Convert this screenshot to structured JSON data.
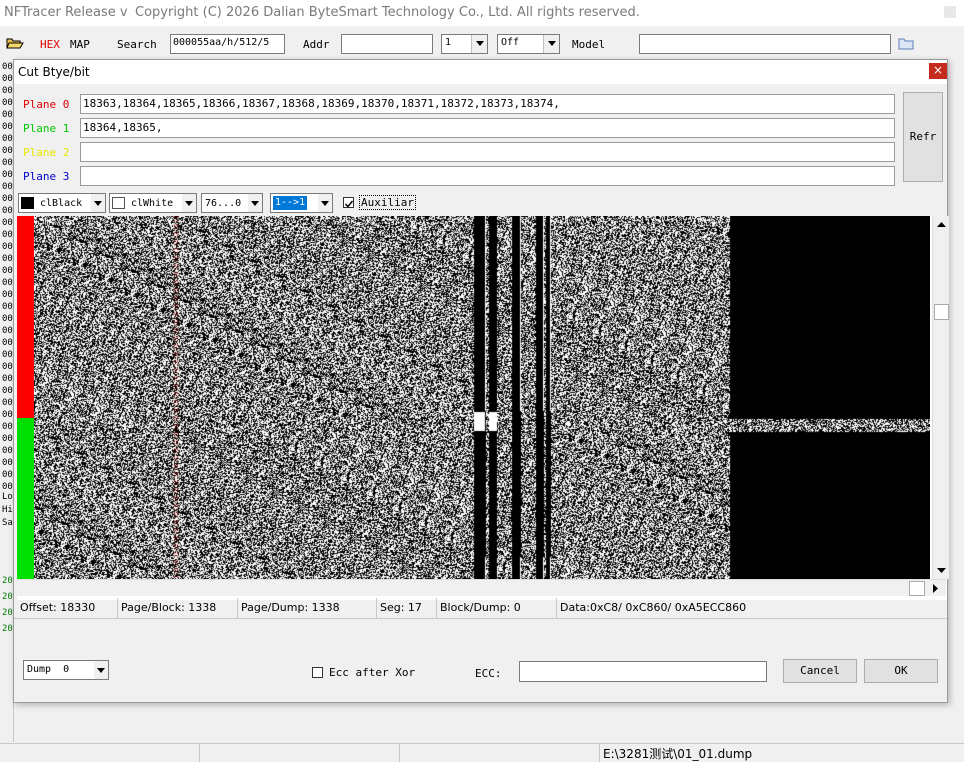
{
  "app": {
    "title": "NFTracer Release v",
    "copyright": "Copyright (C) 2026 Dalian ByteSmart Technology Co., Ltd. All rights reserved."
  },
  "toolbar": {
    "hex_label": "HEX",
    "map_label": "MAP",
    "search_label": "Search",
    "search_value": "000055aa/h/512/5",
    "addr_label": "Addr",
    "addr_value": "",
    "count_value": "1",
    "mode_value": "Off",
    "model_label": "Model",
    "model_value": ""
  },
  "left_strip": {
    "top_rows": [
      "00",
      "00",
      "00",
      "00",
      "00",
      "00",
      "00",
      "00",
      "00",
      "00",
      "00",
      "00",
      "00",
      "00",
      "00",
      "00",
      "00",
      "00",
      "00",
      "00",
      "00",
      "00",
      "00",
      "00",
      "00",
      "00",
      "00",
      "00",
      "00",
      "00",
      "00",
      "00",
      "00",
      "00",
      "00",
      "00",
      "00",
      "00",
      "00",
      "00",
      "00",
      "00",
      "00",
      "00",
      "00"
    ],
    "panel_rows": [
      "Lo",
      "Hi",
      "Sa"
    ],
    "bottom_rows": [
      "20",
      "20",
      "20",
      "20"
    ]
  },
  "dialog": {
    "title": "Cut Btye/bit",
    "close_glyph": "×",
    "planes": [
      {
        "label": "Plane 0",
        "color": "#e00000",
        "value": "18363,18364,18365,18366,18367,18368,18369,18370,18371,18372,18373,18374,"
      },
      {
        "label": "Plane 1",
        "color": "#00c800",
        "value": "18364,18365,"
      },
      {
        "label": "Plane 2",
        "color": "#e8e800",
        "value": ""
      },
      {
        "label": "Plane 3",
        "color": "#0000d0",
        "value": ""
      }
    ],
    "refresh_label": "Refr",
    "controls": {
      "fg_color": "clBlack",
      "bg_color": "clWhite",
      "bit_range": "76...0",
      "direction": "1-->1",
      "auxiliar_label": "Auxiliar",
      "auxiliar_checked": true
    },
    "status": {
      "offset": "Offset: 18330",
      "page_block": "Page/Block: 1338",
      "page_dump": "Page/Dump: 1338",
      "seg": "Seg: 17",
      "block_dump": "Block/Dump: 0",
      "data": "Data:0xC8/ 0xC860/ 0xA5ECC860"
    },
    "dump_value": "Dump  0",
    "ecc_after_xor_label": "Ecc after Xor",
    "ecc_label": "ECC:",
    "ecc_value": "",
    "cancel_label": "Cancel",
    "ok_label": "OK"
  },
  "bottom_status": {
    "path": "E:\\3281测试\\01_01.dump"
  },
  "colors": {
    "plane0": "#e00000",
    "plane1": "#00c800",
    "plane2": "#e8e800",
    "plane3": "#0000d0",
    "hex_red": "#e00000",
    "close_red": "#c42b1c"
  }
}
